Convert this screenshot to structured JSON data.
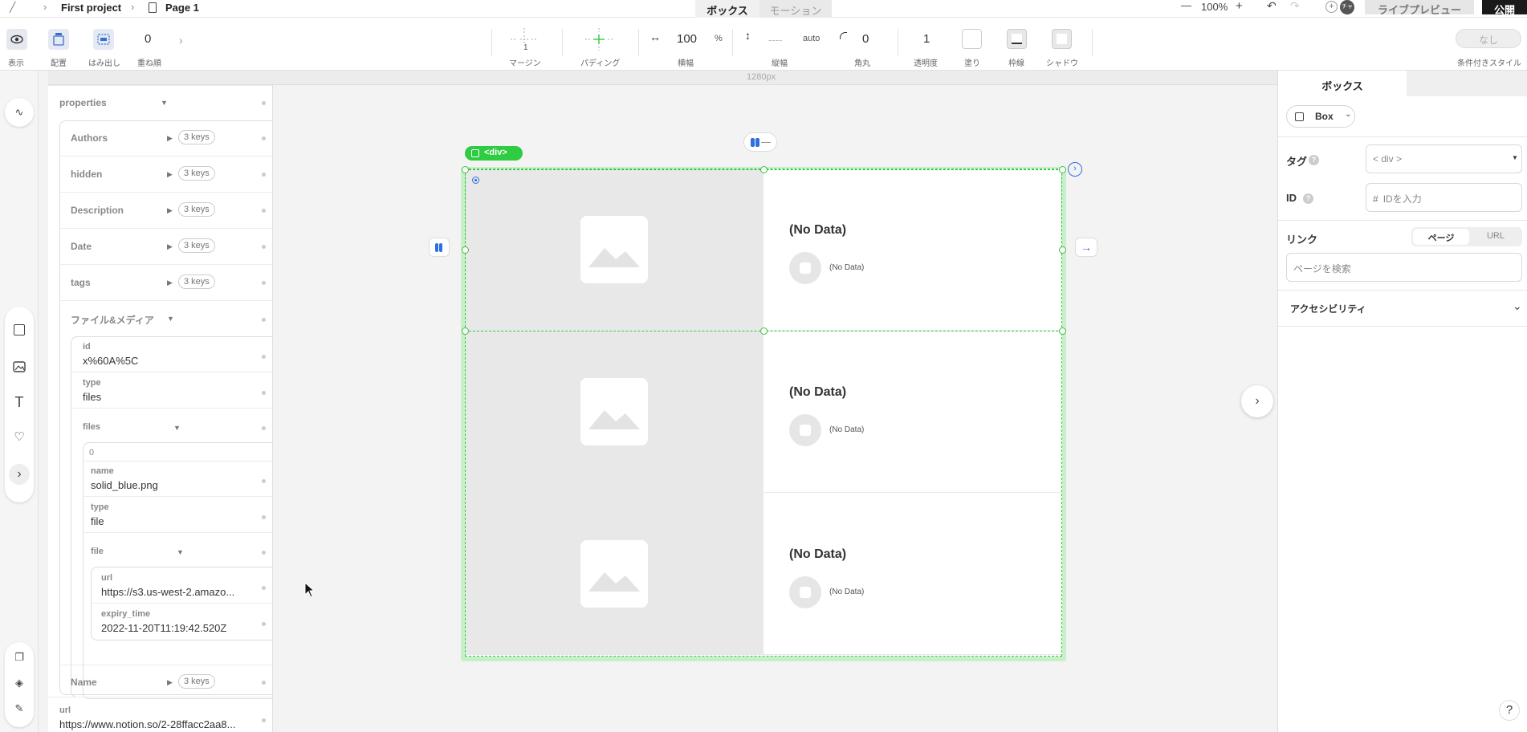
{
  "topbar": {
    "breadcrumb_project": "First project",
    "breadcrumb_page": "Page 1",
    "tab_box": "ボックス",
    "tab_motion": "モーション",
    "zoom_minus": "—",
    "zoom_level": "100%",
    "zoom_plus": "+",
    "avatar_text": "チャ",
    "live_preview": "ライブプレビュー",
    "publish": "公開"
  },
  "toolbar": {
    "show_label": "表示",
    "align_label": "配置",
    "overflow_label": "はみ出し",
    "zindex_label": "重ね順",
    "zindex_value": "0",
    "margin_label": "マージン",
    "margin_value": "1",
    "padding_label": "パディング",
    "width_label": "横幅",
    "width_value": "100",
    "width_unit": "%",
    "height_label": "縦幅",
    "height_value": "----",
    "height_unit": "auto",
    "radius_label": "角丸",
    "radius_value": "0",
    "opacity_label": "透明度",
    "opacity_value": "1",
    "fill_label": "塗り",
    "border_label": "枠線",
    "shadow_label": "シャドウ",
    "conditional_label": "条件付きスタイル",
    "conditional_value": "なし"
  },
  "ruler": {
    "width_label": "1280px"
  },
  "data_panel": {
    "properties_label": "properties",
    "fields": [
      {
        "key": "Authors",
        "badge": "3 keys"
      },
      {
        "key": "hidden",
        "badge": "3 keys"
      },
      {
        "key": "Description",
        "badge": "3 keys"
      },
      {
        "key": "Date",
        "badge": "3 keys"
      },
      {
        "key": "tags",
        "badge": "3 keys"
      }
    ],
    "files_media_label": "ファイル&メディア",
    "id_key": "id",
    "id_value": "x%60A%5C",
    "type_key": "type",
    "type_value": "files",
    "files_key": "files",
    "index_label": "0",
    "name_key": "name",
    "name_value": "solid_blue.png",
    "file_type_key": "type",
    "file_type_value": "file",
    "file_key": "file",
    "url_key": "url",
    "url_value": "https://s3.us-west-2.amazo...",
    "expiry_key": "expiry_time",
    "expiry_value": "2022-11-20T11:19:42.520Z",
    "name_field_key": "Name",
    "name_field_badge": "3 keys",
    "page_url_key": "url",
    "page_url_value": "https://www.notion.so/2-28ffacc2aa8..."
  },
  "canvas": {
    "div_tag_label": "<div>",
    "cards": [
      {
        "title": "(No Data)",
        "subtitle": "(No Data)"
      },
      {
        "title": "(No Data)",
        "subtitle": "(No Data)"
      },
      {
        "title": "(No Data)",
        "subtitle": "(No Data)"
      }
    ]
  },
  "right_panel": {
    "tab_label": "ボックス",
    "component_label": "Box",
    "tag_label": "タグ",
    "tag_value": "< div >",
    "id_label": "ID",
    "id_placeholder": "IDを入力",
    "link_label": "リンク",
    "link_page": "ページ",
    "link_url": "URL",
    "page_search_placeholder": "ページを検索",
    "accessibility_label": "アクセシビリティ"
  },
  "help_label": "?",
  "colors": {
    "selection_green": "#2ecc40",
    "accent_blue": "#2f6fdd",
    "publish_black": "#1a1a1a"
  }
}
